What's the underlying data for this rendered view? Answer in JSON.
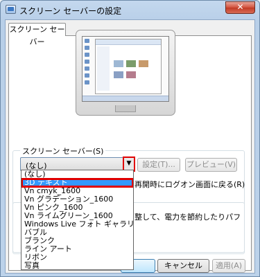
{
  "window": {
    "title": "スクリーン セーバーの設定",
    "close_glyph": "✕"
  },
  "tab": {
    "label": "スクリーン セーバー"
  },
  "screensaver": {
    "group_label": "スクリーン セーバー(S)",
    "selected_value": "(なし)",
    "dropdown_arrow": "▼",
    "settings_button": "設定(T)...",
    "preview_button": "プレビュー(V)",
    "resume_text": "再開時にログオン画面に戻る(R)"
  },
  "power": {
    "text_fragment": "整して、電力を節約したりパフ"
  },
  "dropdown": {
    "options": [
      "(なし)",
      "3D テキスト",
      "Vn cmyk_1600",
      "Vn グラデーション_1600",
      "Vn ピンク_1600",
      "Vn ライムグリーン_1600",
      "Windows Live フォト ギャラリー",
      "バブル",
      "ブランク",
      "ライン アート",
      "リボン",
      "写真"
    ],
    "highlighted_index": 1
  },
  "buttons": {
    "cancel": "キャンセル",
    "apply": "適用(A)"
  },
  "colors": {
    "highlight": "#3399ff",
    "callout_red": "#e00000"
  }
}
